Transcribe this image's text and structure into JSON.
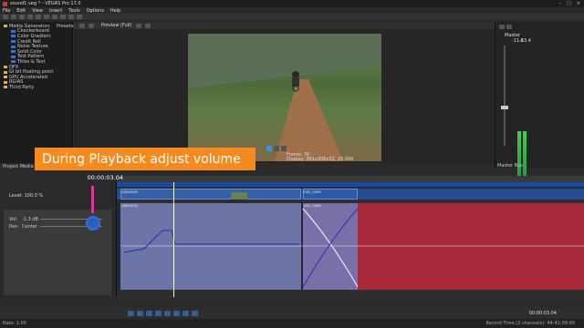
{
  "window": {
    "title": "sound1.veg * - VEGAS Pro 17.0"
  },
  "menu": [
    "File",
    "Edit",
    "View",
    "Insert",
    "Tools",
    "Options",
    "Help"
  ],
  "explorer": {
    "root": "Media Generators",
    "items": [
      "Checkerboard",
      "Color Gradient",
      "Credit Roll",
      "Noise Texture",
      "Solid Color",
      "Test Pattern",
      "Titles & Text"
    ],
    "folders": [
      "OFX",
      "GI bit floating point",
      "GPU Accelerated",
      "RGIAS",
      "Third Party"
    ]
  },
  "presets_label": "Presets:",
  "preview": {
    "quality": "Preview (Full)",
    "frame_label": "Frame:",
    "frame_value": "76",
    "display_label": "Display:",
    "display_value": "301x206x32, 25.000"
  },
  "master": {
    "label": "Master",
    "bus_label": "Master Bus",
    "db_values": [
      "-11.6",
      "-13.4"
    ]
  },
  "banner_text": "During Playback adjust volume",
  "project_media_tab": "Project Media",
  "timecode": "00:00:03.04",
  "track": {
    "level_label": "Level: 100.0 %",
    "vol_label": "Vol:",
    "vol_value": "-1.3 dB",
    "pan_label": "Pan:",
    "pan_value": "Center"
  },
  "clips": {
    "video1": "VID00028",
    "video2": "DSC_0096",
    "audio1": "VID00028",
    "audio2": "DSC_0096"
  },
  "status": {
    "rate": "Rate: 1.00",
    "record_time": "Record Time (2 channels): 44:41:09:00",
    "transport_time": "00:00:03.04"
  },
  "colors": {
    "banner": "#f58a1f",
    "audio_event": "#6d74a8",
    "audio_event_red": "#a82a3a",
    "video_track": "#254b8f"
  }
}
